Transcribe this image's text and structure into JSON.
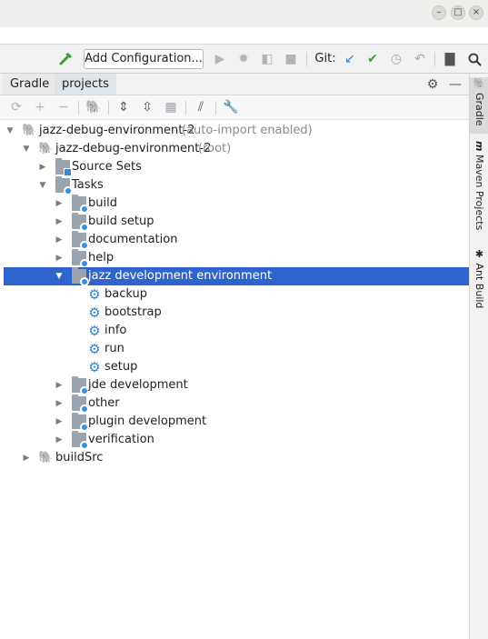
{
  "window": {
    "minimize_glyph": "–",
    "maximize_glyph": "□",
    "close_glyph": "×"
  },
  "toolbar": {
    "build_icon": "hammer-icon",
    "add_configuration": "Add Configuration...",
    "git_label": "Git:",
    "colors": {
      "green": "#3e9d3c",
      "blue": "#2f83d6",
      "gray": "#a8a8a8"
    }
  },
  "panel": {
    "tabs": [
      {
        "label": "Gradle"
      },
      {
        "label": "projects"
      }
    ]
  },
  "tree": {
    "rows": [
      {
        "label": "jazz-debug-environment-2",
        "suffix": "(auto-import enabled)"
      },
      {
        "label": "jazz-debug-environment-2",
        "suffix": "(root)"
      },
      {
        "label": "Source Sets"
      },
      {
        "label": "Tasks"
      },
      {
        "label": "build"
      },
      {
        "label": "build setup"
      },
      {
        "label": "documentation"
      },
      {
        "label": "help"
      },
      {
        "label": "jazz development environment"
      },
      {
        "label": "backup"
      },
      {
        "label": "bootstrap"
      },
      {
        "label": "info"
      },
      {
        "label": "run"
      },
      {
        "label": "setup"
      },
      {
        "label": "jde development"
      },
      {
        "label": "other"
      },
      {
        "label": "plugin development"
      },
      {
        "label": "verification"
      },
      {
        "label": "buildSrc"
      }
    ]
  },
  "right_sidebar": {
    "tabs": [
      {
        "label": "Gradle"
      },
      {
        "label": "Maven Projects"
      },
      {
        "label": "Ant Build"
      }
    ]
  },
  "colors": {
    "selection": "#2f65ca",
    "accent_blue": "#2f83d6"
  }
}
